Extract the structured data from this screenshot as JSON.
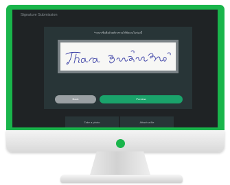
{
  "monitor": {
    "frame_color": "#19b54b",
    "screen_color": "#1f2325",
    "power_indicator_color": "#19b54b"
  },
  "app": {
    "title": "Signature Submission"
  },
  "modal": {
    "instruction": "*กรุณาเซ็นชื่อด้วยตัวบรรจงให้ชัดเจนในช่องนี้",
    "signature_text": "Thara  Jayasawatphichit",
    "back_label": "Back",
    "preview_label": "Preview",
    "preview_color": "#1aa36b"
  },
  "options": {
    "take_photo_label": "Take a photo",
    "attach_file_label": "Attach a file"
  }
}
